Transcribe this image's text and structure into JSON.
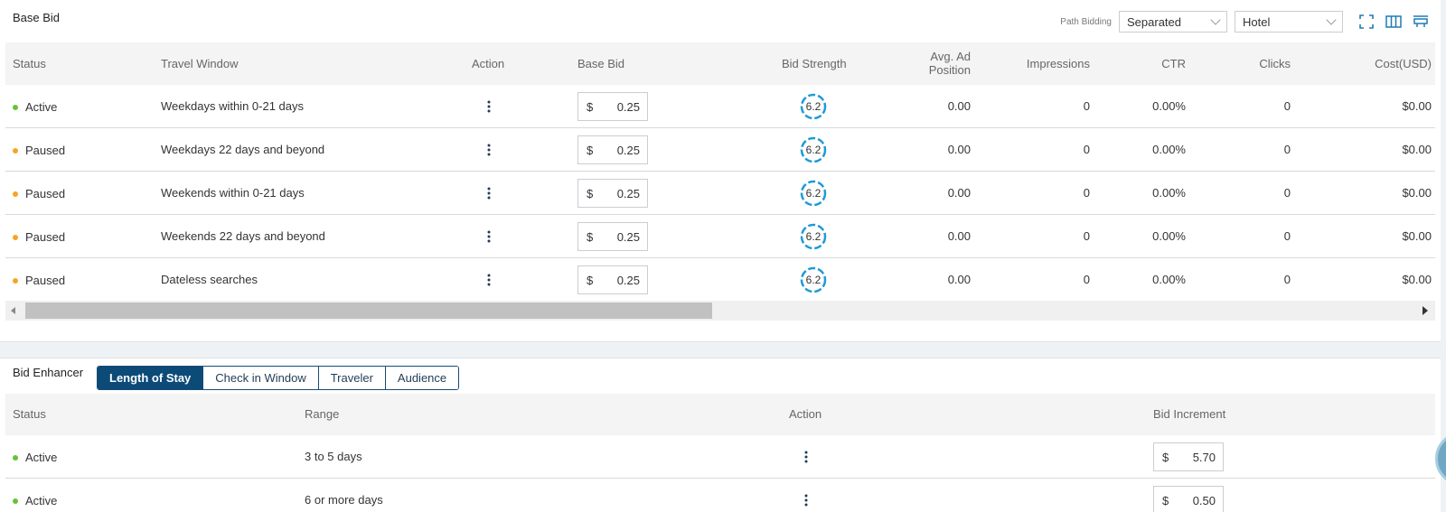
{
  "base_bid": {
    "title": "Base Bid",
    "toolbar": {
      "path_label": "Path Bidding",
      "path_select": "Separated",
      "type_select": "Hotel",
      "icons": [
        "fullscreen-icon",
        "columns-icon",
        "sticky-icon"
      ]
    },
    "columns": [
      "Status",
      "Travel Window",
      "Action",
      "Base Bid",
      "Bid Strength",
      "Avg. Ad",
      "Position",
      "Impressions",
      "CTR",
      "Clicks",
      "Cost(USD)"
    ],
    "rows": [
      {
        "status": "Active",
        "status_color": "#67c23a",
        "window": "Weekdays within 0-21 days",
        "currency": "$",
        "bid": "0.25",
        "strength": "6.2",
        "avg_pos": "0.00",
        "impressions": "0",
        "ctr": "0.00%",
        "clicks": "0",
        "cost": "$0.00"
      },
      {
        "status": "Paused",
        "status_color": "#f5a623",
        "window": "Weekdays 22 days and beyond",
        "currency": "$",
        "bid": "0.25",
        "strength": "6.2",
        "avg_pos": "0.00",
        "impressions": "0",
        "ctr": "0.00%",
        "clicks": "0",
        "cost": "$0.00"
      },
      {
        "status": "Paused",
        "status_color": "#f5a623",
        "window": "Weekends within 0-21 days",
        "currency": "$",
        "bid": "0.25",
        "strength": "6.2",
        "avg_pos": "0.00",
        "impressions": "0",
        "ctr": "0.00%",
        "clicks": "0",
        "cost": "$0.00"
      },
      {
        "status": "Paused",
        "status_color": "#f5a623",
        "window": "Weekends 22 days and beyond",
        "currency": "$",
        "bid": "0.25",
        "strength": "6.2",
        "avg_pos": "0.00",
        "impressions": "0",
        "ctr": "0.00%",
        "clicks": "0",
        "cost": "$0.00"
      },
      {
        "status": "Paused",
        "status_color": "#f5a623",
        "window": "Dateless searches",
        "currency": "$",
        "bid": "0.25",
        "strength": "6.2",
        "avg_pos": "0.00",
        "impressions": "0",
        "ctr": "0.00%",
        "clicks": "0",
        "cost": "$0.00"
      }
    ]
  },
  "bid_enhancer": {
    "title": "Bid Enhancer",
    "tabs": [
      {
        "label": "Length of Stay",
        "active": true
      },
      {
        "label": "Check in Window",
        "active": false
      },
      {
        "label": "Traveler",
        "active": false
      },
      {
        "label": "Audience",
        "active": false
      }
    ],
    "columns": [
      "Status",
      "Range",
      "Action",
      "Bid Increment"
    ],
    "rows": [
      {
        "status": "Active",
        "status_color": "#67c23a",
        "range": "3 to 5 days",
        "currency": "$",
        "increment": "5.70"
      },
      {
        "status": "Active",
        "status_color": "#67c23a",
        "range": "6 or more days",
        "currency": "$",
        "increment": "0.50"
      }
    ]
  },
  "colors": {
    "accent": "#0c4a78",
    "gauge": "#1f9ad6",
    "active": "#67c23a",
    "paused": "#f5a623"
  }
}
